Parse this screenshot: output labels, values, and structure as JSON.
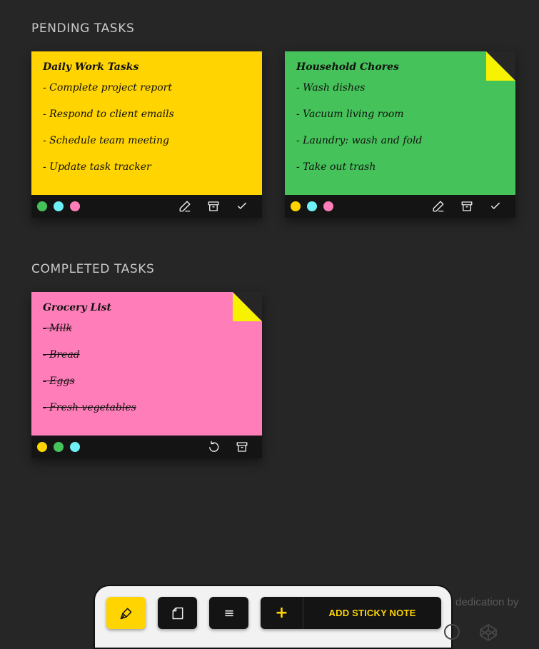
{
  "sections": {
    "pending": "PENDING TASKS",
    "completed": "COMPLETED TASKS"
  },
  "notes": [
    {
      "title": "Daily Work Tasks",
      "color": "#ffd400",
      "items": [
        "- Complete project report",
        "- Respond to client emails",
        "- Schedule team meeting",
        "- Update task tracker"
      ],
      "swatches": [
        "#45c35a",
        "#6ef0f7",
        "#ff7eb9"
      ]
    },
    {
      "title": "Household Chores",
      "color": "#45c35a",
      "items": [
        "- Wash dishes",
        "- Vacuum living room",
        "- Laundry: wash and fold",
        "- Take out trash"
      ],
      "swatches": [
        "#ffd400",
        "#6ef0f7",
        "#ff7eb9"
      ]
    },
    {
      "title": "Grocery List",
      "color": "#ff7eb9",
      "items": [
        "- Milk",
        "- Bread",
        "- Eggs",
        "- Fresh vegetables"
      ],
      "swatches": [
        "#ffd400",
        "#45c35a",
        "#6ef0f7"
      ]
    }
  ],
  "toolbar": {
    "plus": "+",
    "add_label": "ADD STICKY NOTE"
  },
  "footer": {
    "dedication": "dedication by"
  },
  "icons": {
    "edit": "pencil-icon",
    "archive": "archive-icon",
    "complete": "check-icon",
    "restore": "undo-icon",
    "pen_tool": "pen-nib-icon",
    "note": "note-icon",
    "menu": "menu-icon"
  }
}
